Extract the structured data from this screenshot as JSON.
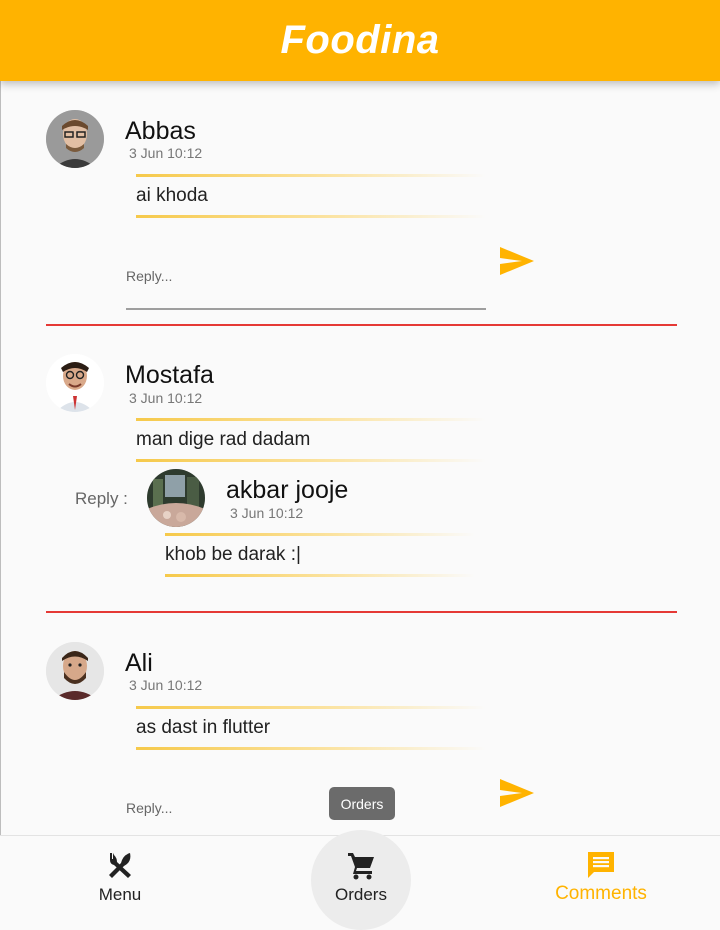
{
  "app": {
    "title": "Foodina"
  },
  "comments": [
    {
      "author": "Abbas",
      "time": "3 Jun 10:12",
      "message": "ai khoda",
      "reply_placeholder": "Reply..."
    },
    {
      "author": "Mostafa",
      "time": "3 Jun 10:12",
      "message": "man dige rad dadam",
      "reply_label": "Reply :",
      "reply": {
        "author": "akbar jooje",
        "time": "3 Jun 10:12",
        "message": "khob be darak :|"
      }
    },
    {
      "author": "Ali",
      "time": "3 Jun 10:12",
      "message": "as dast in flutter",
      "reply_placeholder": "Reply..."
    }
  ],
  "tooltip": "Orders",
  "bottom_nav": {
    "items": [
      {
        "label": "Menu",
        "icon": "fork-knife-icon"
      },
      {
        "label": "Orders",
        "icon": "cart-icon"
      },
      {
        "label": "Comments",
        "icon": "comment-icon",
        "active": true
      }
    ]
  },
  "colors": {
    "accent": "#ffb300",
    "divider": "#e53935"
  }
}
